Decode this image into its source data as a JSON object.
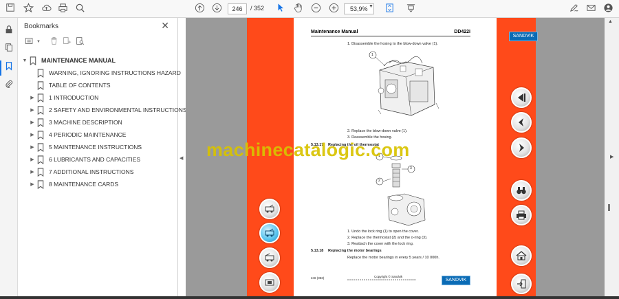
{
  "toolbar": {
    "page_current": "246",
    "page_total": "/ 352",
    "zoom": "53,9%"
  },
  "bookmarks": {
    "title": "Bookmarks",
    "items": [
      {
        "label": "MAINTENANCE MANUAL",
        "level": 0,
        "expandable": true,
        "expanded": true
      },
      {
        "label": "WARNING, IGNORING INSTRUCTIONS HAZARD",
        "level": 1,
        "expandable": false
      },
      {
        "label": "TABLE OF CONTENTS",
        "level": 1,
        "expandable": false
      },
      {
        "label": "1 INTRODUCTION",
        "level": 1,
        "expandable": true
      },
      {
        "label": "2 SAFETY AND ENVIRONMENTAL INSTRUCTIONS",
        "level": 1,
        "expandable": true
      },
      {
        "label": "3 MACHINE DESCRIPTION",
        "level": 1,
        "expandable": true
      },
      {
        "label": "4 PERIODIC MAINTENANCE",
        "level": 1,
        "expandable": true
      },
      {
        "label": "5 MAINTENANCE INSTRUCTIONS",
        "level": 1,
        "expandable": true
      },
      {
        "label": "6 LUBRICANTS AND CAPACITIES",
        "level": 1,
        "expandable": true
      },
      {
        "label": "7 ADDITIONAL INSTRUCTIONS",
        "level": 1,
        "expandable": true
      },
      {
        "label": "8 MAINTENANCE CARDS",
        "level": 1,
        "expandable": true
      }
    ]
  },
  "document": {
    "header_left": "Maintenance Manual",
    "header_right": "DD422i",
    "brand": "SANDVIK",
    "step1": "1.   Disassemble the hosing to the blow-down valve (1).",
    "step2": "2.   Replace the blow-down valve (1).",
    "step3": "3.   Reassemble the hosing.",
    "sec1_num": "5.13.17",
    "sec1_title": "Replacing the oil thermostat",
    "s2_step1": "1.   Undo the lock ring (1) to open the cover.",
    "s2_step2": "2.   Replace the thermostat (2) and the o-ring (3).",
    "s2_step3": "3.   Reattach the cover with the lock ring.",
    "sec2_num": "5.13.18",
    "sec2_title": "Replacing the motor bearings",
    "sec2_text": "Replace the motor bearings in every 5 years / 10 000h.",
    "footer_page": "246 (352)",
    "footer_copy": "Copyright © Sandvik",
    "callout_1": "1",
    "callout_2": "2",
    "callout_3": "3"
  },
  "watermark": "machinecatalogic.com",
  "colors": {
    "strip": "#ff4a1a",
    "accent": "#1473e6",
    "brand_blue": "#0a6bb5",
    "watermark": "#d8c300"
  }
}
